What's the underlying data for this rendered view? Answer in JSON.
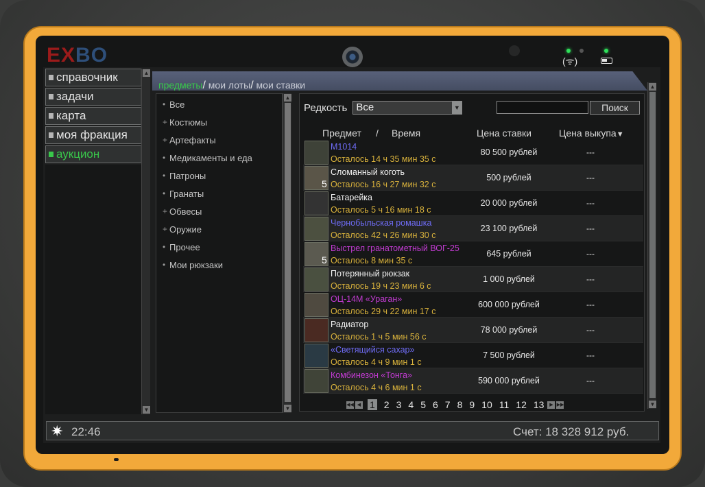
{
  "brand": {
    "logo_a": "EX",
    "logo_b": "BO"
  },
  "sidebar": {
    "items": [
      {
        "label": "справочник"
      },
      {
        "label": "задачи"
      },
      {
        "label": "карта"
      },
      {
        "label": "моя фракция"
      },
      {
        "label": "аукцион",
        "active": true
      }
    ]
  },
  "tabs": {
    "items": [
      "предметы",
      "мои лоты",
      "мои ставки"
    ],
    "separator": "/"
  },
  "categories": [
    {
      "marker": "•",
      "label": "Все"
    },
    {
      "marker": "+",
      "label": "Костюмы"
    },
    {
      "marker": "+",
      "label": "Артефакты"
    },
    {
      "marker": "•",
      "label": "Медикаменты и еда"
    },
    {
      "marker": "•",
      "label": "Патроны"
    },
    {
      "marker": "•",
      "label": "Гранаты"
    },
    {
      "marker": "+",
      "label": "Обвесы"
    },
    {
      "marker": "+",
      "label": "Оружие"
    },
    {
      "marker": "•",
      "label": "Прочее"
    },
    {
      "marker": "•",
      "label": "Мои рюкзаки"
    }
  ],
  "filter": {
    "label": "Редкость",
    "value": "Все",
    "search_button": "Поиск"
  },
  "columns": {
    "item": "Предмет",
    "slash": "/",
    "time": "Время",
    "bid": "Цена ставки",
    "buyout": "Цена выкупа",
    "sort_icon": "▼"
  },
  "rows": [
    {
      "name": "М1014",
      "color": "blue",
      "time": "Осталось 14 ч 35 мин 35 с",
      "bid": "80 500 рублей",
      "buyout": "---",
      "qty": ""
    },
    {
      "name": "Сломанный коготь",
      "color": "white",
      "time": "Осталось 16 ч 27 мин 32 с",
      "bid": "500 рублей",
      "buyout": "---",
      "qty": "5"
    },
    {
      "name": "Батарейка",
      "color": "white",
      "time": "Осталось 5 ч 16 мин 18 с",
      "bid": "20 000 рублей",
      "buyout": "---",
      "qty": ""
    },
    {
      "name": "Чернобыльская ромашка",
      "color": "blue",
      "time": "Осталось 42 ч 26 мин 30 с",
      "bid": "23 100 рублей",
      "buyout": "---",
      "qty": ""
    },
    {
      "name": "Выстрел гранатометный ВОГ-25",
      "color": "purple",
      "time": "Осталось 8 мин 35 с",
      "bid": "645 рублей",
      "buyout": "---",
      "qty": "5"
    },
    {
      "name": "Потерянный рюкзак",
      "color": "white",
      "time": "Осталось 19 ч 23 мин 6 с",
      "bid": "1 000 рублей",
      "buyout": "---",
      "qty": ""
    },
    {
      "name": "ОЦ-14М «Ураган»",
      "color": "purple",
      "time": "Осталось 29 ч 22 мин 17 с",
      "bid": "600 000 рублей",
      "buyout": "---",
      "qty": ""
    },
    {
      "name": "Радиатор",
      "color": "white",
      "time": "Осталось 1 ч 5 мин 56 с",
      "bid": "78 000 рублей",
      "buyout": "---",
      "qty": ""
    },
    {
      "name": "«Светящийся сахар»",
      "color": "blue",
      "time": "Осталось 4 ч 9 мин 1 с",
      "bid": "7 500 рублей",
      "buyout": "---",
      "qty": ""
    },
    {
      "name": "Комбинезон «Тонга»",
      "color": "purple",
      "time": "Осталось 4 ч 6 мин 1 с",
      "bid": "590 000 рублей",
      "buyout": "---",
      "qty": ""
    }
  ],
  "pager": {
    "pages": [
      "1",
      "2",
      "3",
      "4",
      "5",
      "6",
      "7",
      "8",
      "9",
      "10",
      "11",
      "12",
      "13"
    ],
    "current": "1"
  },
  "status": {
    "time": "22:46",
    "balance": "Счет: 18 328 912 руб."
  },
  "colors": {
    "accent_green": "#39c84b",
    "name_blue": "#6f6cf6",
    "name_purple": "#c13bd1",
    "time_gold": "#d9b23c",
    "frame_orange": "#f2a93a"
  }
}
